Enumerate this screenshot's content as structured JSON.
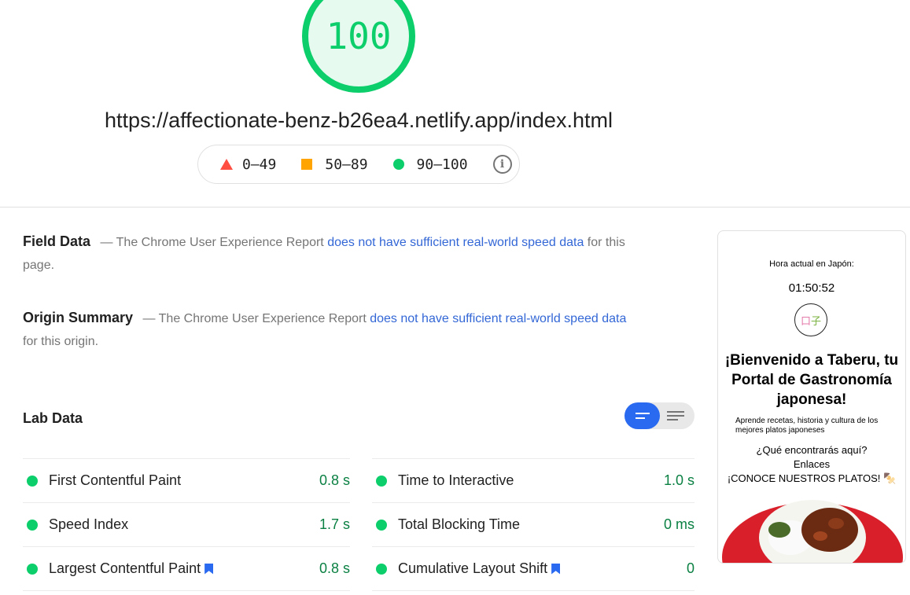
{
  "score": "100",
  "url": "https://affectionate-benz-b26ea4.netlify.app/index.html",
  "legend": {
    "fail": "0–49",
    "average": "50–89",
    "pass": "90–100"
  },
  "field_data": {
    "title": "Field Data",
    "prefix": "— The Chrome User Experience Report",
    "link": "does not have sufficient real-world speed data",
    "suffix": "for this page."
  },
  "origin_summary": {
    "title": "Origin Summary",
    "prefix": "— The Chrome User Experience Report",
    "link": "does not have sufficient real-world speed data",
    "suffix": "for this origin."
  },
  "lab_data": {
    "title": "Lab Data",
    "left": [
      {
        "label": "First Contentful Paint",
        "value": "0.8 s"
      },
      {
        "label": "Speed Index",
        "value": "1.7 s"
      },
      {
        "label": "Largest Contentful Paint",
        "value": "0.8 s"
      }
    ],
    "right": [
      {
        "label": "Time to Interactive",
        "value": "1.0 s"
      },
      {
        "label": "Total Blocking Time",
        "value": "0 ms"
      },
      {
        "label": "Cumulative Layout Shift",
        "value": "0"
      }
    ]
  },
  "screenshot": {
    "time_label": "Hora actual en Japón:",
    "time": "01:50:52",
    "welcome": "¡Bienvenido a Taberu, tu Portal de Gastronomía japonesa!",
    "subtitle": "Aprende recetas, historia y cultura de los mejores platos japoneses",
    "question": "¿Qué encontrarás aquí?",
    "links": "Enlaces",
    "platos": "¡CONOCE NUESTROS PLATOS! 🍢"
  },
  "colors": {
    "pass": "#0cce6b",
    "average": "#ffa400",
    "fail": "#ff4e42",
    "link": "#3367d6",
    "toggle": "#2a6af1"
  }
}
